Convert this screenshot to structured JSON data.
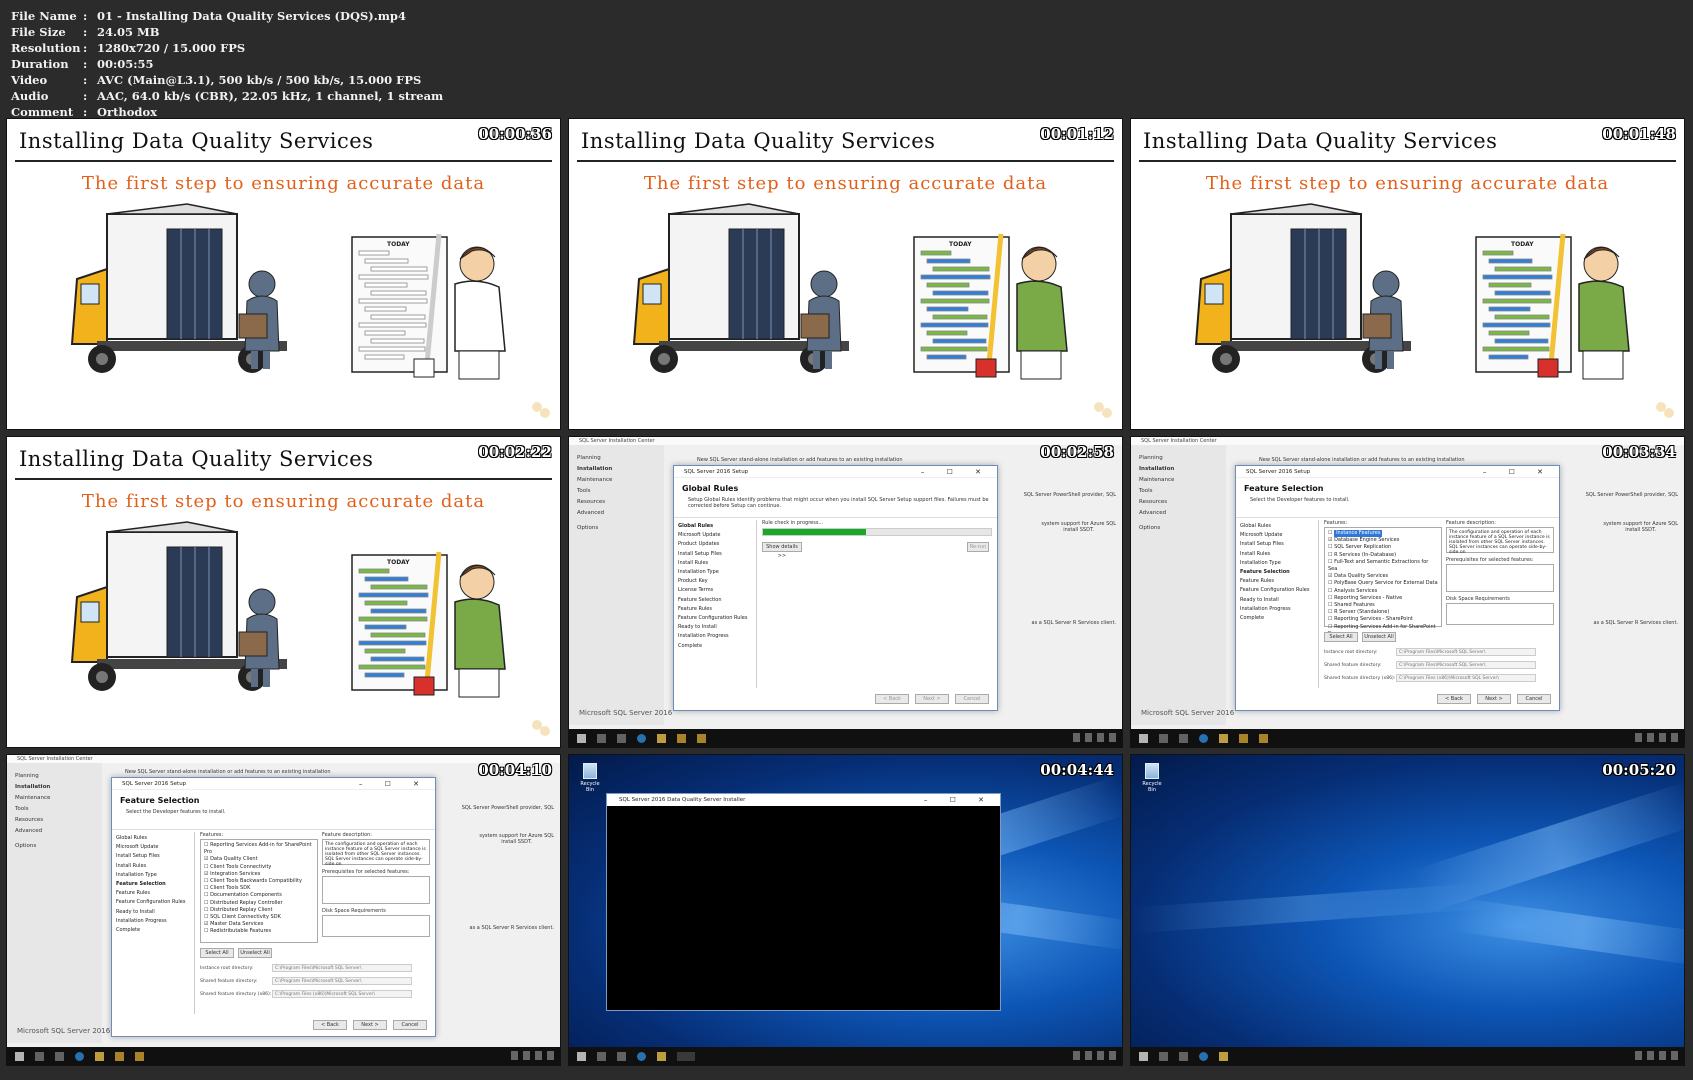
{
  "meta": {
    "rows": [
      {
        "key": "File Name",
        "value": "01 - Installing Data Quality Services (DQS).mp4"
      },
      {
        "key": "File Size",
        "value": "24.05 MB"
      },
      {
        "key": "Resolution",
        "value": "1280x720 / 15.000 FPS"
      },
      {
        "key": "Duration",
        "value": "00:05:55"
      },
      {
        "key": "Video",
        "value": "AVC (Main@L3.1), 500 kb/s / 500 kb/s, 15.000 FPS"
      },
      {
        "key": "Audio",
        "value": "AAC, 64.0 kb/s (CBR), 22.05 kHz, 1 channel, 1 stream"
      },
      {
        "key": "Comment",
        "value": "Orthodox"
      }
    ]
  },
  "slide": {
    "title": "Installing Data Quality Services",
    "subtitle": "The first step to ensuring accurate data",
    "board_label": "TODAY"
  },
  "thumbs": [
    {
      "time": "00:00:36"
    },
    {
      "time": "00:01:12"
    },
    {
      "time": "00:01:48"
    },
    {
      "time": "00:02:22"
    },
    {
      "time": "00:02:58"
    },
    {
      "time": "00:03:34"
    },
    {
      "time": "00:04:10"
    },
    {
      "time": "00:04:44"
    },
    {
      "time": "00:05:20"
    }
  ],
  "sic": {
    "window_title": "SQL Server Installation Center",
    "nav": [
      "Planning",
      "Installation",
      "Maintenance",
      "Tools",
      "Resources",
      "Advanced",
      "Options"
    ],
    "brand": "Microsoft SQL Server 2016",
    "link_text": "New SQL Server stand-alone installation or add features to an existing installation",
    "right_1": "SQL Server PowerShell provider, SQL",
    "right_2": "system support for Azure SQL",
    "right_3": "install SSDT.",
    "right_4": "as a SQL Server R Services client."
  },
  "setup": {
    "window_title": "SQL Server 2016 Setup",
    "global_rules": {
      "heading": "Global Rules",
      "desc": "Setup Global Rules identify problems that might occur when you install SQL Server Setup support files. Failures must be corrected before Setup can continue.",
      "status": "Rule check in progress...",
      "show_details": "Show details >>",
      "rerun": "Re-run",
      "progress": 0.45
    },
    "nav": [
      "Global Rules",
      "Microsoft Update",
      "Product Updates",
      "Install Setup Files",
      "Install Rules",
      "Installation Type",
      "Product Key",
      "License Terms",
      "Feature Selection",
      "Feature Rules",
      "Feature Configuration Rules",
      "Ready to Install",
      "Installation Progress",
      "Complete"
    ],
    "nav_short": [
      "Global Rules",
      "Microsoft Update",
      "Install Setup Files",
      "Install Rules",
      "Installation Type",
      "Feature Selection",
      "Feature Rules",
      "Feature Configuration Rules",
      "Ready to Install",
      "Installation Progress",
      "Complete"
    ],
    "feature": {
      "heading": "Feature Selection",
      "desc": "Select the Developer features to install.",
      "features_label": "Features:",
      "desc_label": "Feature description:",
      "desc_text": "The configuration and operation of each instance feature of a SQL Server instance is isolated from other SQL Server instances. SQL Server instances can operate side-by-side on",
      "prereq_label": "Prerequisites for selected features:",
      "disk_label": "Disk Space Requirements",
      "tree_a": [
        "Instance Features",
        "Database Engine Services",
        "SQL Server Replication",
        "R Services (In-Database)",
        "Full-Text and Semantic Extractions for Sea",
        "Data Quality Services",
        "PolyBase Query Service for External Data",
        "Analysis Services",
        "Reporting Services - Native",
        "Shared Features",
        "R Server (Standalone)",
        "Reporting Services - SharePoint",
        "Reporting Services Add-in for SharePoint Pro"
      ],
      "tree_b": [
        "Reporting Services Add-in for SharePoint Pro",
        "Data Quality Client",
        "Client Tools Connectivity",
        "Integration Services",
        "Client Tools Backwards Compatibility",
        "Client Tools SDK",
        "Documentation Components",
        "Distributed Replay Controller",
        "Distributed Replay Client",
        "SQL Client Connectivity SDK",
        "Master Data Services",
        "Redistributable Features"
      ],
      "select_all": "Select All",
      "unselect_all": "Unselect All",
      "instance_root_label": "Instance root directory:",
      "instance_root_value": "C:\\Program Files\\Microsoft SQL Server\\",
      "shared_label": "Shared feature directory:",
      "shared_value": "C:\\Program Files\\Microsoft SQL Server\\",
      "shared86_label": "Shared feature directory (x86):",
      "shared86_value": "C:\\Program Files (x86)\\Microsoft SQL Server\\"
    },
    "back": "< Back",
    "next": "Next >",
    "cancel": "Cancel"
  },
  "desktop": {
    "recycle_bin": "Recycle Bin",
    "console_title": "SQL Server 2016 Data Quality Server Installer"
  }
}
